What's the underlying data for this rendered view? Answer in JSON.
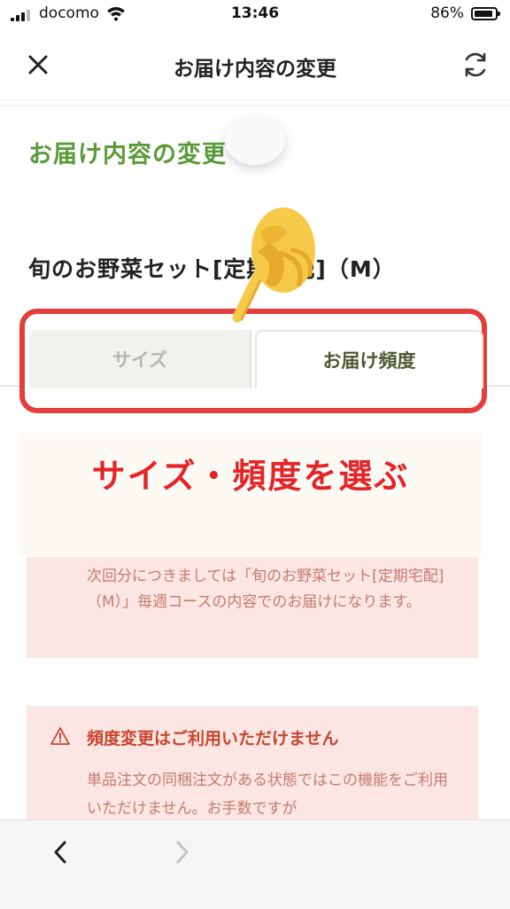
{
  "status_bar": {
    "carrier": "docomo",
    "time": "13:46",
    "battery_percent": "86%"
  },
  "header": {
    "title": "お届け内容の変更",
    "close_icon": "close-icon",
    "refresh_icon": "refresh-icon"
  },
  "section_title": "お届け内容の変更",
  "product_name": "旬のお野菜セット[定期宅配]（M）",
  "tabs": [
    {
      "label": "サイズ",
      "selected": false
    },
    {
      "label": "お届け頻度",
      "selected": true
    }
  ],
  "caption": "サイズ・頻度を選ぶ",
  "notice_info": {
    "text": "次回分につきましては「旬のお野菜セット[定期宅配]（M）」毎週コースの内容でのお届けになります。"
  },
  "notice_warning": {
    "icon": "warning-icon",
    "title": "頻度変更はご利用いただけません",
    "body": "単品注文の同梱注文がある状態ではこの機能をご利用いただけません。お手数ですが"
  },
  "colors": {
    "accent_green": "#5a9a3a",
    "highlight_red": "#e53c3c",
    "notice_bg": "#fbe6e4"
  }
}
